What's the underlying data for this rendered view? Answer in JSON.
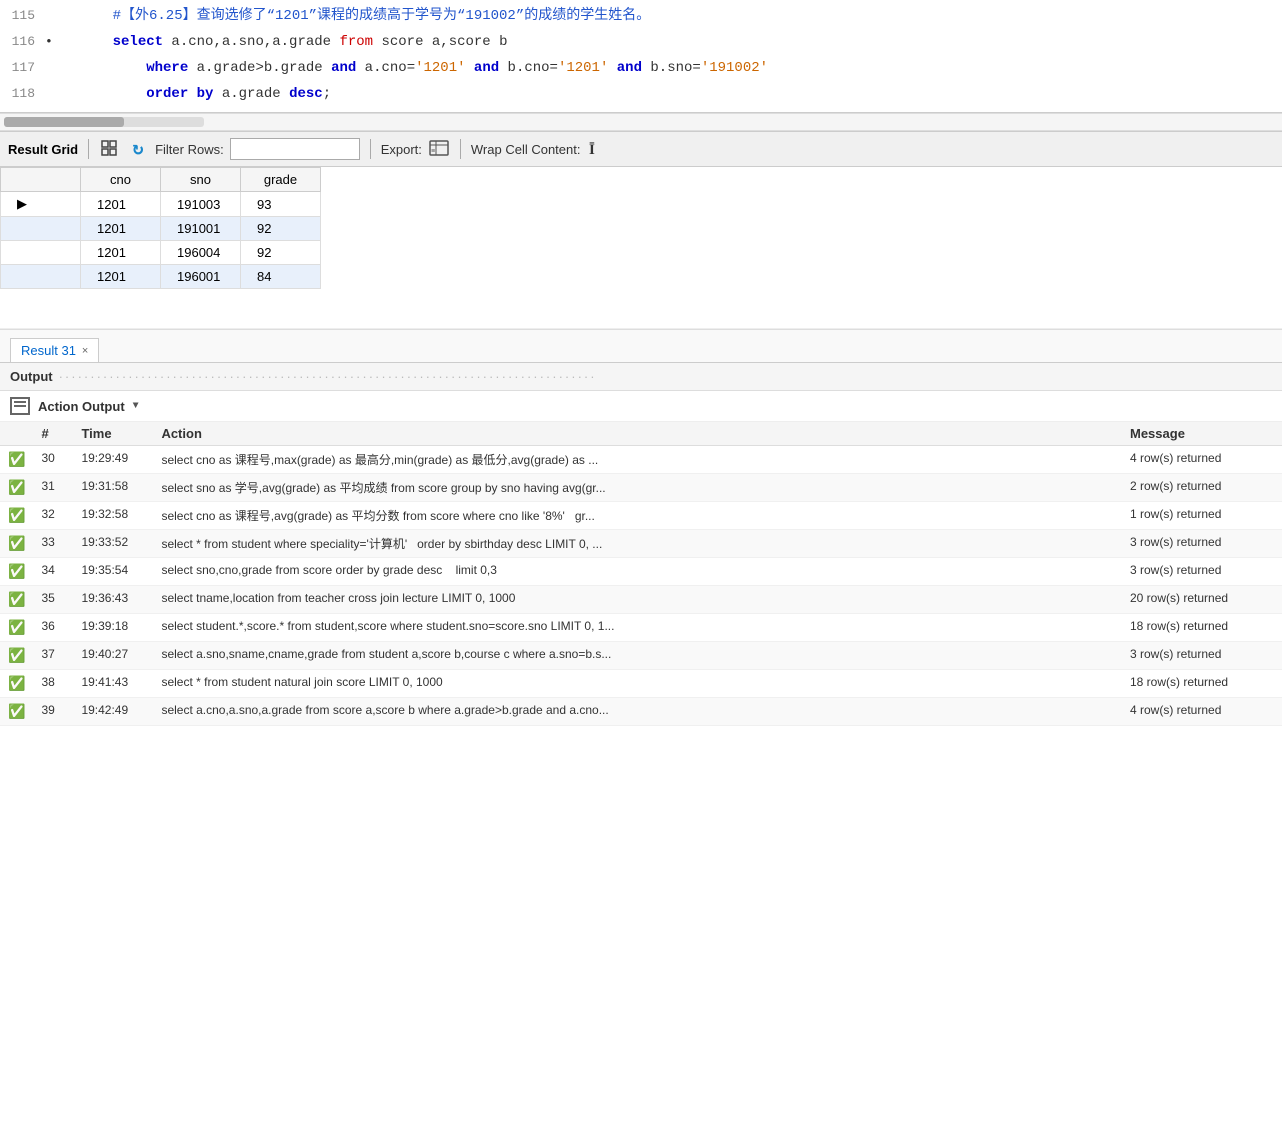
{
  "code": {
    "lines": [
      {
        "number": "115",
        "bullet": "",
        "indent": 0,
        "tokens": [
          {
            "text": "    #【外6.25】查询选修了“1201”课程的成绩高于学号为“191002”的成绩的学生姓名。",
            "class": "comment-blue"
          }
        ]
      },
      {
        "number": "116",
        "bullet": "•",
        "indent": 0,
        "tokens": [
          {
            "text": "    ",
            "class": "text-normal"
          },
          {
            "text": "select",
            "class": "kw-blue"
          },
          {
            "text": " a.cno,a.sno,a.grade ",
            "class": "text-normal"
          },
          {
            "text": "from",
            "class": "kw-from"
          },
          {
            "text": " score a,score b",
            "class": "text-normal"
          }
        ]
      },
      {
        "number": "117",
        "bullet": "",
        "indent": 1,
        "tokens": [
          {
            "text": "        ",
            "class": "text-normal"
          },
          {
            "text": "where",
            "class": "kw-blue"
          },
          {
            "text": " a.grade>b.grade ",
            "class": "text-normal"
          },
          {
            "text": "and",
            "class": "kw-blue"
          },
          {
            "text": " a.cno=",
            "class": "text-normal"
          },
          {
            "text": "'1201'",
            "class": "str-orange"
          },
          {
            "text": "  ",
            "class": "text-normal"
          },
          {
            "text": "and",
            "class": "kw-blue"
          },
          {
            "text": " b.cno=",
            "class": "text-normal"
          },
          {
            "text": "'1201'",
            "class": "str-orange"
          },
          {
            "text": " ",
            "class": "text-normal"
          },
          {
            "text": "and",
            "class": "kw-blue"
          },
          {
            "text": " b.sno=",
            "class": "text-normal"
          },
          {
            "text": "'191002'",
            "class": "str-orange"
          }
        ]
      },
      {
        "number": "118",
        "bullet": "",
        "indent": 1,
        "tokens": [
          {
            "text": "        ",
            "class": "text-normal"
          },
          {
            "text": "order",
            "class": "kw-blue"
          },
          {
            "text": " ",
            "class": "text-normal"
          },
          {
            "text": "by",
            "class": "kw-blue"
          },
          {
            "text": " a.grade ",
            "class": "text-normal"
          },
          {
            "text": "desc",
            "class": "kw-blue"
          },
          {
            "text": ";",
            "class": "text-normal"
          }
        ]
      }
    ]
  },
  "toolbar": {
    "result_grid_label": "Result Grid",
    "filter_rows_label": "Filter Rows:",
    "filter_placeholder": "",
    "export_label": "Export:",
    "wrap_label": "Wrap Cell Content:"
  },
  "table": {
    "columns": [
      "cno",
      "sno",
      "grade"
    ],
    "rows": [
      {
        "indicator": "▶",
        "cno": "1201",
        "sno": "191003",
        "grade": "93"
      },
      {
        "indicator": "",
        "cno": "1201",
        "sno": "191001",
        "grade": "92"
      },
      {
        "indicator": "",
        "cno": "1201",
        "sno": "196004",
        "grade": "92"
      },
      {
        "indicator": "",
        "cno": "1201",
        "sno": "196001",
        "grade": "84"
      }
    ]
  },
  "result_tab": {
    "label": "Result 31",
    "close_label": "×"
  },
  "output": {
    "title": "Output",
    "dots": "·····················································································"
  },
  "action_output": {
    "label": "Action Output",
    "dropdown": "▼",
    "columns": [
      "#",
      "Time",
      "Action",
      "Message"
    ],
    "rows": [
      {
        "num": "30",
        "time": "19:29:49",
        "action": "select cno as 课程号,max(grade) as 最高分,min(grade) as 最低分,avg(grade) as ...",
        "message": "4 row(s) returned"
      },
      {
        "num": "31",
        "time": "19:31:58",
        "action": "select sno as 学号,avg(grade) as 平均成绩 from score group by sno having avg(gr...",
        "message": "2 row(s) returned"
      },
      {
        "num": "32",
        "time": "19:32:58",
        "action": "select cno as 课程号,avg(grade) as 平均分数 from score where cno like '8%'   gr...",
        "message": "1 row(s) returned"
      },
      {
        "num": "33",
        "time": "19:33:52",
        "action": "select * from student where speciality='计算机'   order by sbirthday desc LIMIT 0, ...",
        "message": "3 row(s) returned"
      },
      {
        "num": "34",
        "time": "19:35:54",
        "action": "select sno,cno,grade from score order by grade desc    limit 0,3",
        "message": "3 row(s) returned"
      },
      {
        "num": "35",
        "time": "19:36:43",
        "action": "select tname,location from teacher cross join lecture LIMIT 0, 1000",
        "message": "20 row(s) returned"
      },
      {
        "num": "36",
        "time": "19:39:18",
        "action": "select student.*,score.* from student,score where student.sno=score.sno LIMIT 0, 1...",
        "message": "18 row(s) returned"
      },
      {
        "num": "37",
        "time": "19:40:27",
        "action": "select a.sno,sname,cname,grade from student a,score b,course c where a.sno=b.s...",
        "message": "3 row(s) returned"
      },
      {
        "num": "38",
        "time": "19:41:43",
        "action": "select * from student natural join score LIMIT 0, 1000",
        "message": "18 row(s) returned"
      },
      {
        "num": "39",
        "time": "19:42:49",
        "action": "select a.cno,a.sno,a.grade from score a,score b where a.grade>b.grade and a.cno...",
        "message": "4 row(s) returned"
      }
    ]
  }
}
